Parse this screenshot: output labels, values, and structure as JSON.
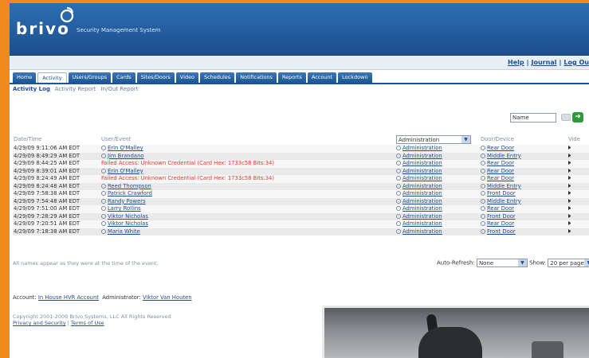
{
  "brand": {
    "logo_text": "brivo",
    "tagline": "Security Management System"
  },
  "toplinks": [
    "Help",
    "Journal",
    "Log Ou"
  ],
  "tabs": [
    "Home",
    "Activity",
    "Users/Groups",
    "Cards",
    "Sites/Doors",
    "Video",
    "Schedules",
    "Notifications",
    "Reports",
    "Account",
    "Lockdown"
  ],
  "active_tab": "Activity",
  "subtabs": [
    "Activity Log",
    "Activity Report",
    "In/Out Report"
  ],
  "filter": {
    "name_value": "Name",
    "group_select": "Administration"
  },
  "table": {
    "headers": [
      "Date/Time",
      "User/Event",
      "",
      "Door/Device",
      "Vide"
    ],
    "rows": [
      {
        "time": "4/29/09 9:11:06 AM EDT",
        "event": "Erin O'Malley",
        "fail": false,
        "group": "Administration",
        "door": "Rear Door"
      },
      {
        "time": "4/29/09 8:49:29 AM EDT",
        "event": "Jim Brandano",
        "fail": false,
        "group": "Administration",
        "door": "Middle Entry"
      },
      {
        "time": "4/29/09 8:44:25 AM EDT",
        "event": "Failed Access: Unknown Credential (Card Hex: 1733c58 Bits:34)",
        "fail": true,
        "group": "Administration",
        "door": "Rear Door"
      },
      {
        "time": "4/29/09 8:39:01 AM EDT",
        "event": "Erin O'Malley",
        "fail": false,
        "group": "Administration",
        "door": "Rear Door"
      },
      {
        "time": "4/29/09 8:24:49 AM EDT",
        "event": "Failed Access: Unknown Credential (Card Hex: 1733c58 Bits:34)",
        "fail": true,
        "group": "Administration",
        "door": "Rear Door"
      },
      {
        "time": "4/29/09 8:24:48 AM EDT",
        "event": "Reed Thompson",
        "fail": false,
        "group": "Administration",
        "door": "Middle Entry"
      },
      {
        "time": "4/29/09 7:58:38 AM EDT",
        "event": "Patrick Crawford",
        "fail": false,
        "group": "Administration",
        "door": "Front Door"
      },
      {
        "time": "4/29/09 7:54:48 AM EDT",
        "event": "Randy Powers",
        "fail": false,
        "group": "Administration",
        "door": "Middle Entry"
      },
      {
        "time": "4/29/09 7:51:00 AM EDT",
        "event": "Larry Rollins",
        "fail": false,
        "group": "Administration",
        "door": "Rear Door"
      },
      {
        "time": "4/29/09 7:28:29 AM EDT",
        "event": "Viktor Nicholas",
        "fail": false,
        "group": "Administration",
        "door": "Front Door"
      },
      {
        "time": "4/29/09 7:20:51 AM EDT",
        "event": "Viktor Nicholas",
        "fail": false,
        "group": "Administration",
        "door": "Rear Door"
      },
      {
        "time": "4/29/09 7:18:38 AM EDT",
        "event": "Maria White",
        "fail": false,
        "group": "Administration",
        "door": "Front Door"
      }
    ]
  },
  "footnote": "All names appear as they were at the time of the event.",
  "auto_refresh": {
    "label": "Auto-Refresh:",
    "value": "None",
    "show_label": "Show:",
    "show_value": "20 per page"
  },
  "account": {
    "account_label": "Account:",
    "account_name": "In House HVR Account",
    "admin_label": "Administrator:",
    "admin_name": "Viktor Van Houten"
  },
  "copyright": {
    "text": "Copyright 2001-2009 Brivo Systems, LLC All Rights Reserved",
    "privacy": "Privacy and Security",
    "terms": "Terms of Use"
  },
  "colors": {
    "page_orange": "#f08a1c",
    "header_blue": "#1c4f8e",
    "fail_red": "#e03a2a"
  }
}
